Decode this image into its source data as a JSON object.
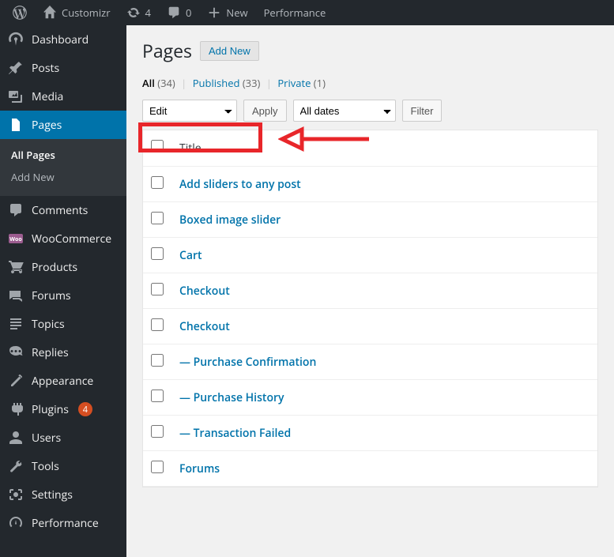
{
  "adminbar": {
    "site_name": "Customizr",
    "updates_count": "4",
    "comments_count": "0",
    "new_label": "New",
    "performance_label": "Performance"
  },
  "sidebar": {
    "dashboard": "Dashboard",
    "posts": "Posts",
    "media": "Media",
    "pages": "Pages",
    "pages_sub_all": "All Pages",
    "pages_sub_add": "Add New",
    "comments": "Comments",
    "woocommerce": "WooCommerce",
    "products": "Products",
    "forums": "Forums",
    "topics": "Topics",
    "replies": "Replies",
    "appearance": "Appearance",
    "plugins": "Plugins",
    "plugins_count": "4",
    "users": "Users",
    "tools": "Tools",
    "settings": "Settings",
    "performance": "Performance"
  },
  "page": {
    "title": "Pages",
    "add_new": "Add New"
  },
  "filters": {
    "all_label": "All",
    "all_count": "(34)",
    "published_label": "Published",
    "published_count": "(33)",
    "private_label": "Private",
    "private_count": "(1)"
  },
  "bulk": {
    "action": "Edit",
    "apply": "Apply",
    "dates": "All dates",
    "filter": "Filter"
  },
  "table": {
    "title_header": "Title",
    "rows": [
      {
        "title": "Add sliders to any post"
      },
      {
        "title": "Boxed image slider"
      },
      {
        "title": "Cart"
      },
      {
        "title": "Checkout"
      },
      {
        "title": "Checkout"
      },
      {
        "title": "— Purchase Confirmation"
      },
      {
        "title": "— Purchase History"
      },
      {
        "title": "— Transaction Failed"
      },
      {
        "title": "Forums"
      }
    ]
  }
}
